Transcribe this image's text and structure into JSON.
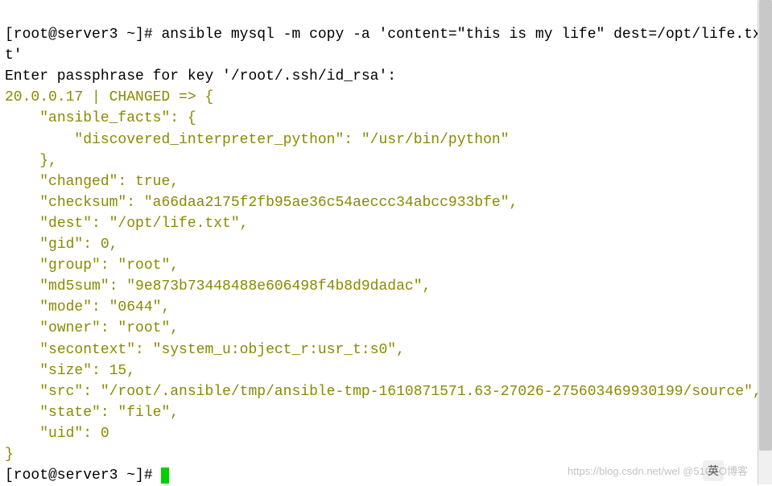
{
  "prompt1_prefix": "[root@server3 ~]# ",
  "command": "ansible mysql -m copy -a 'content=\"this is my life\" dest=/opt/life.txt'",
  "passphrase_line": "Enter passphrase for key '/root/.ssh/id_rsa':",
  "status_header": "20.0.0.17 | CHANGED => {",
  "l1": "    \"ansible_facts\": {",
  "l2": "        \"discovered_interpreter_python\": \"/usr/bin/python\"",
  "l3": "    },",
  "l4": "    \"changed\": true,",
  "l5": "    \"checksum\": \"a66daa2175f2fb95ae36c54aeccc34abcc933bfe\",",
  "l6": "    \"dest\": \"/opt/life.txt\",",
  "l7": "    \"gid\": 0,",
  "l8": "    \"group\": \"root\",",
  "l9": "    \"md5sum\": \"9e873b73448488e606498f4b8d9dadac\",",
  "l10": "    \"mode\": \"0644\",",
  "l11": "    \"owner\": \"root\",",
  "l12": "    \"secontext\": \"system_u:object_r:usr_t:s0\",",
  "l13": "    \"size\": 15,",
  "l14": "    \"src\": \"/root/.ansible/tmp/ansible-tmp-1610871571.63-27026-275603469930199/source\",",
  "l15": "    \"state\": \"file\",",
  "l16": "    \"uid\": 0",
  "close_brace": "}",
  "prompt2_prefix": "[root@server3 ~]# ",
  "watermark": "https://blog.csdn.net/wel @51CTO博客",
  "ime": "英"
}
